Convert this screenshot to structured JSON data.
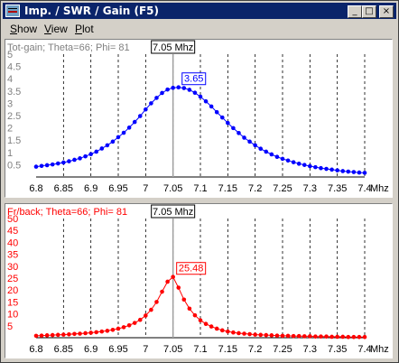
{
  "window": {
    "title": "Imp. / SWR / Gain   (F5)",
    "min_glyph": "_",
    "max_glyph": "□",
    "close_glyph": "×"
  },
  "menu": [
    {
      "label": "Show",
      "underline": "S"
    },
    {
      "label": "View",
      "underline": "V"
    },
    {
      "label": "Plot",
      "underline": "P"
    }
  ],
  "chart_data": [
    {
      "type": "line",
      "title": "Tot-gain; Theta=66; Phi= 81",
      "cursor_label": "7.05 Mhz",
      "peak_label": "3.65",
      "x_unit": "Mhz",
      "x_ticks": [
        "6.8",
        "6.85",
        "6.9",
        "6.95",
        "7",
        "7.05",
        "7.1",
        "7.15",
        "7.2",
        "7.25",
        "7.3",
        "7.35",
        "7.4"
      ],
      "y_ticks": [
        "0.5",
        "1",
        "1.5",
        "2",
        "2.5",
        "3",
        "3.5",
        "4",
        "4.5",
        "5"
      ],
      "xlim": [
        6.8,
        7.4
      ],
      "ylim": [
        0,
        5
      ],
      "cursor_x": 7.05,
      "peak": [
        7.06,
        3.65
      ],
      "line_color": "#0000ff",
      "grid": "vertical dashed",
      "series": [
        {
          "x": [
            6.8,
            6.81,
            6.82,
            6.83,
            6.84,
            6.85,
            6.86,
            6.87,
            6.88,
            6.89,
            6.9,
            6.91,
            6.92,
            6.93,
            6.94,
            6.95,
            6.96,
            6.97,
            6.98,
            6.99,
            7.0,
            7.01,
            7.02,
            7.03,
            7.04,
            7.05,
            7.06,
            7.07,
            7.08,
            7.09,
            7.1,
            7.11,
            7.12,
            7.13,
            7.14,
            7.15,
            7.16,
            7.17,
            7.18,
            7.19,
            7.2,
            7.21,
            7.22,
            7.23,
            7.24,
            7.25,
            7.26,
            7.27,
            7.28,
            7.29,
            7.3,
            7.31,
            7.32,
            7.33,
            7.34,
            7.35,
            7.36,
            7.37,
            7.38,
            7.39,
            7.4
          ],
          "values": [
            0.42,
            0.45,
            0.48,
            0.51,
            0.55,
            0.59,
            0.64,
            0.7,
            0.76,
            0.84,
            0.93,
            1.03,
            1.16,
            1.29,
            1.44,
            1.62,
            1.8,
            2.01,
            2.24,
            2.48,
            2.75,
            3.0,
            3.22,
            3.42,
            3.56,
            3.63,
            3.65,
            3.62,
            3.55,
            3.43,
            3.27,
            3.08,
            2.87,
            2.64,
            2.42,
            2.2,
            1.99,
            1.79,
            1.6,
            1.44,
            1.29,
            1.15,
            1.03,
            0.92,
            0.82,
            0.74,
            0.67,
            0.6,
            0.54,
            0.49,
            0.44,
            0.4,
            0.36,
            0.33,
            0.3,
            0.27,
            0.24,
            0.22,
            0.2,
            0.18,
            0.17
          ]
        }
      ]
    },
    {
      "type": "line",
      "title": "Fr/back; Theta=66; Phi= 81",
      "cursor_label": "7.05 Mhz",
      "peak_label": "25.48",
      "x_unit": "Mhz",
      "x_ticks": [
        "6.8",
        "6.85",
        "6.9",
        "6.95",
        "7",
        "7.05",
        "7.1",
        "7.15",
        "7.2",
        "7.25",
        "7.3",
        "7.35",
        "7.4"
      ],
      "y_ticks": [
        "5",
        "10",
        "15",
        "20",
        "25",
        "30",
        "35",
        "40",
        "45",
        "50"
      ],
      "xlim": [
        6.8,
        7.4
      ],
      "ylim": [
        0,
        50
      ],
      "cursor_x": 7.05,
      "peak": [
        7.05,
        25.48
      ],
      "line_color": "#ff0000",
      "grid": "vertical dashed",
      "series": [
        {
          "x": [
            6.8,
            6.81,
            6.82,
            6.83,
            6.84,
            6.85,
            6.86,
            6.87,
            6.88,
            6.89,
            6.9,
            6.91,
            6.92,
            6.93,
            6.94,
            6.95,
            6.96,
            6.97,
            6.98,
            6.99,
            7.0,
            7.01,
            7.02,
            7.03,
            7.04,
            7.05,
            7.06,
            7.07,
            7.08,
            7.09,
            7.1,
            7.11,
            7.12,
            7.13,
            7.14,
            7.15,
            7.16,
            7.17,
            7.18,
            7.19,
            7.2,
            7.21,
            7.22,
            7.23,
            7.24,
            7.25,
            7.26,
            7.27,
            7.28,
            7.29,
            7.3,
            7.31,
            7.32,
            7.33,
            7.34,
            7.35,
            7.36,
            7.37,
            7.38,
            7.39,
            7.4
          ],
          "values": [
            0.8,
            0.9,
            1.0,
            1.1,
            1.2,
            1.3,
            1.4,
            1.6,
            1.7,
            1.9,
            2.1,
            2.3,
            2.6,
            2.9,
            3.3,
            3.8,
            4.4,
            5.2,
            6.2,
            7.5,
            9.3,
            11.7,
            15.0,
            19.3,
            23.5,
            25.5,
            21.0,
            16.0,
            12.2,
            9.4,
            7.3,
            5.8,
            4.7,
            3.8,
            3.1,
            2.6,
            2.2,
            1.9,
            1.7,
            1.5,
            1.3,
            1.2,
            1.1,
            1.0,
            0.9,
            0.8,
            0.8,
            0.7,
            0.7,
            0.6,
            0.6,
            0.5,
            0.5,
            0.5,
            0.4,
            0.4,
            0.4,
            0.3,
            0.3,
            0.3,
            0.3
          ]
        }
      ]
    }
  ]
}
